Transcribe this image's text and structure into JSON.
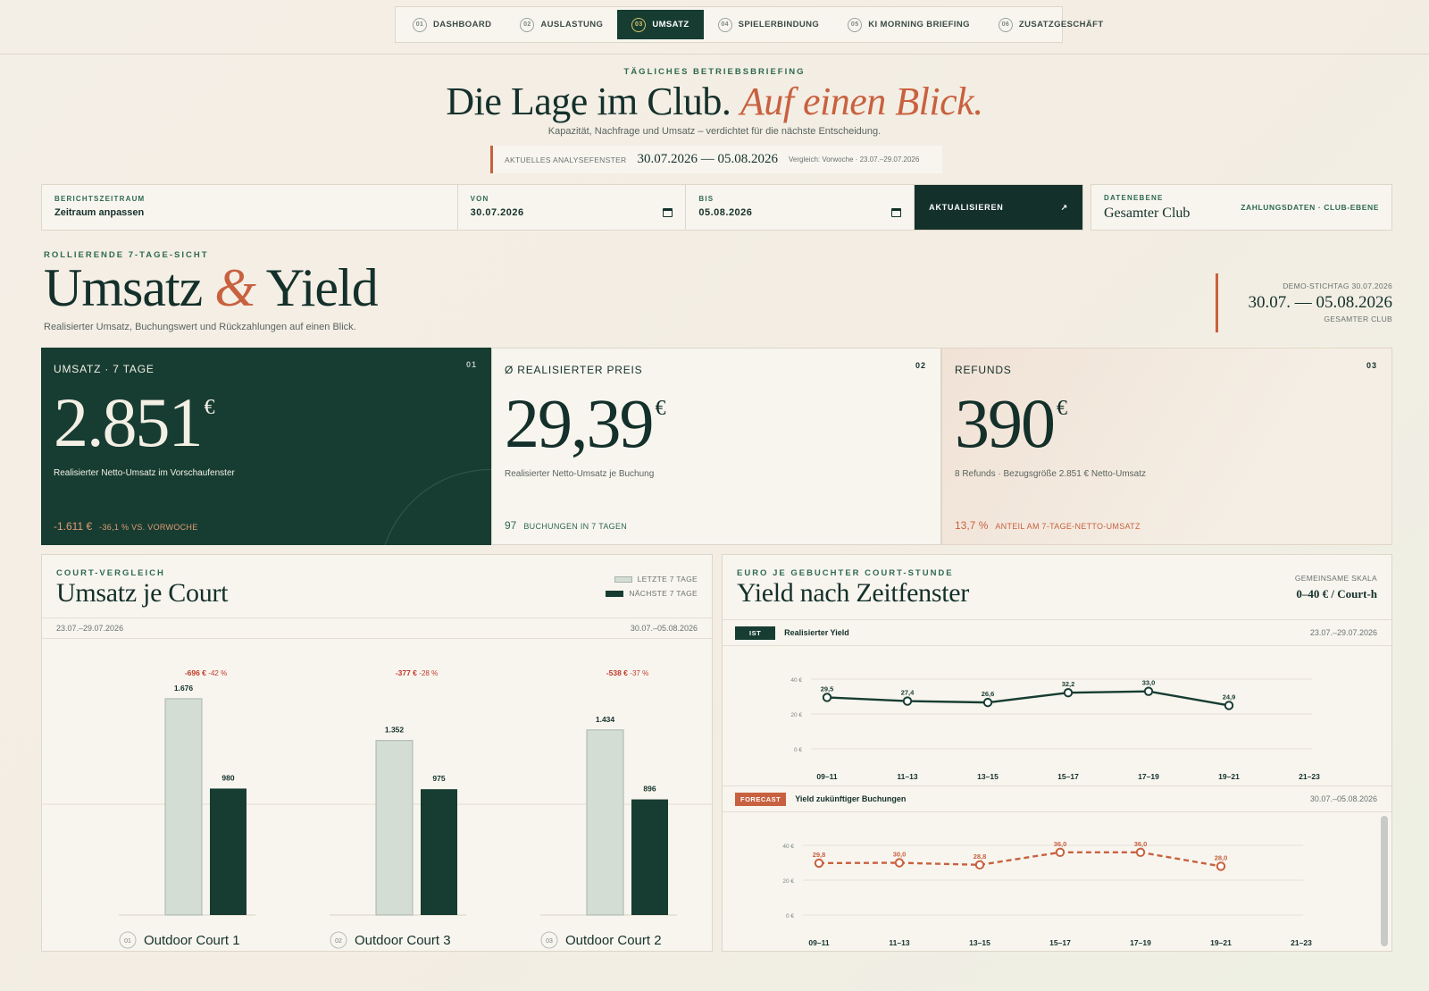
{
  "nav": {
    "items": [
      {
        "num": "01",
        "label": "DASHBOARD"
      },
      {
        "num": "02",
        "label": "AUSLASTUNG"
      },
      {
        "num": "03",
        "label": "UMSATZ"
      },
      {
        "num": "04",
        "label": "SPIELERBINDUNG"
      },
      {
        "num": "05",
        "label": "KI MORNING BRIEFING"
      },
      {
        "num": "06",
        "label": "ZUSATZGESCHÄFT"
      }
    ],
    "active": "UMSATZ"
  },
  "hero": {
    "eyebrow": "TÄGLICHES BETRIEBSBRIEFING",
    "title_main": "Die Lage im Club.",
    "title_accent": "Auf einen Blick.",
    "subtitle": "Kapazität, Nachfrage und Umsatz – verdichtet für die nächste Entscheidung.",
    "window_label": "AKTUELLES ANALYSEFENSTER",
    "window_dates": "30.07.2026 — 05.08.2026",
    "window_compare": "Vergleich: Vorwoche · 23.07.–29.07.2026"
  },
  "filter": {
    "period_label": "BERICHTSZEITRAUM",
    "period_value": "Zeitraum anpassen",
    "from_label": "VON",
    "from_value": "30.07.2026",
    "to_label": "BIS",
    "to_value": "05.08.2026",
    "update_label": "AKTUALISIEREN",
    "update_icon": "↗",
    "level_label": "DATENEBENE",
    "level_value": "Gesamter Club",
    "level_right": "ZAHLUNGSDATEN · CLUB-EBENE"
  },
  "section": {
    "eyebrow": "ROLLIERENDE 7-TAGE-SICHT",
    "title_a": "Umsatz",
    "title_amp": "&",
    "title_b": "Yield",
    "subtitle": "Realisierter Umsatz, Buchungswert und Rückzahlungen auf einen Blick.",
    "stichtag_label": "DEMO-STICHTAG 30.07.2026",
    "stichtag_dates": "30.07. — 05.08.2026",
    "stichtag_scope": "GESAMTER CLUB"
  },
  "kpis": [
    {
      "label": "UMSATZ · 7 TAGE",
      "no": "01",
      "value": "2.851",
      "unit": "€",
      "desc": "Realisierter Netto-Umsatz im Vorschaufenster",
      "foot_big": "-1.611 €",
      "foot_small": "-36,1 % VS. VORWOCHE"
    },
    {
      "label": "Ø REALISIERTER PREIS",
      "no": "02",
      "value": "29,39",
      "unit": "€",
      "desc": "Realisierter Netto-Umsatz je Buchung",
      "foot_big": "97",
      "foot_small": "BUCHUNGEN IN 7 TAGEN"
    },
    {
      "label": "REFUNDS",
      "no": "03",
      "value": "390",
      "unit": "€",
      "desc": "8 Refunds · Bezugsgröße 2.851 € Netto-Umsatz",
      "foot_big": "13,7 %",
      "foot_small": "ANTEIL AM 7-TAGE-NETTO-UMSATZ"
    }
  ],
  "court_panel": {
    "eyebrow": "COURT-VERGLEICH",
    "title": "Umsatz je Court",
    "legend_last": "LETZTE 7 TAGE",
    "legend_next": "NÄCHSTE 7 TAGE",
    "date_left": "23.07.–29.07.2026",
    "date_right": "30.07.–05.08.2026",
    "courts": [
      {
        "num": "01",
        "name": "Outdoor Court 1"
      },
      {
        "num": "02",
        "name": "Outdoor Court 3"
      },
      {
        "num": "03",
        "name": "Outdoor Court 2"
      }
    ]
  },
  "yield_panel": {
    "eyebrow": "EURO JE GEBUCHTER COURT-STUNDE",
    "title": "Yield nach Zeitfenster",
    "scale_label": "GEMEINSAME SKALA",
    "scale_value": "0–40 € / Court-h",
    "ist_tag": "IST",
    "ist_name": "Realisierter Yield",
    "ist_dates": "23.07.–29.07.2026",
    "fc_tag": "FORECAST",
    "fc_name": "Yield zukünftiger Buchungen",
    "fc_dates": "30.07.–05.08.2026"
  },
  "colors": {
    "accent": "#c8613f",
    "primary": "#173d32",
    "green_label": "#2e6a4f",
    "bar_last": "#d4ddd3",
    "delta_red": "#c0392b"
  },
  "chart_data": [
    {
      "type": "bar",
      "categories": [
        "Outdoor Court 1",
        "Outdoor Court 3",
        "Outdoor Court 2"
      ],
      "series": [
        {
          "name": "LETZTE 7 TAGE",
          "values": [
            1676,
            1352,
            1434
          ],
          "labels": [
            "1.676",
            "1.352",
            "1.434"
          ]
        },
        {
          "name": "NÄCHSTE 7 TAGE",
          "values": [
            980,
            975,
            896
          ],
          "labels": [
            "980",
            "975",
            "896"
          ]
        }
      ],
      "deltas": [
        {
          "abs": "-696 €",
          "pct": "-42 %"
        },
        {
          "abs": "-377 €",
          "pct": "-28 %"
        },
        {
          "abs": "-538 €",
          "pct": "-37 %"
        }
      ],
      "ylim": [
        0,
        1800
      ]
    },
    {
      "type": "line",
      "x": [
        "09–11",
        "11–13",
        "13–15",
        "15–17",
        "17–19",
        "19–21",
        "21–23"
      ],
      "series": [
        {
          "name": "Realisierter Yield",
          "values": [
            29.5,
            27.4,
            26.6,
            32.2,
            33.0,
            24.9
          ],
          "labels": [
            "29,5",
            "27,4",
            "26,6",
            "32,2",
            "33,0",
            "24,9"
          ]
        }
      ],
      "y_ticks": [
        "40 €",
        "20 €",
        "0 €"
      ],
      "ylim": [
        0,
        40
      ]
    },
    {
      "type": "line",
      "x": [
        "09–11",
        "11–13",
        "13–15",
        "15–17",
        "17–19",
        "19–21",
        "21–23"
      ],
      "series": [
        {
          "name": "Yield zukünftiger Buchungen",
          "values": [
            29.8,
            30.0,
            28.8,
            36.0,
            36.0,
            28.0
          ],
          "labels": [
            "29,8",
            "30,0",
            "28,8",
            "36,0",
            "36,0",
            "28,0"
          ]
        }
      ],
      "y_ticks": [
        "40 €",
        "20 €",
        "0 €"
      ],
      "ylim": [
        0,
        40
      ]
    }
  ]
}
